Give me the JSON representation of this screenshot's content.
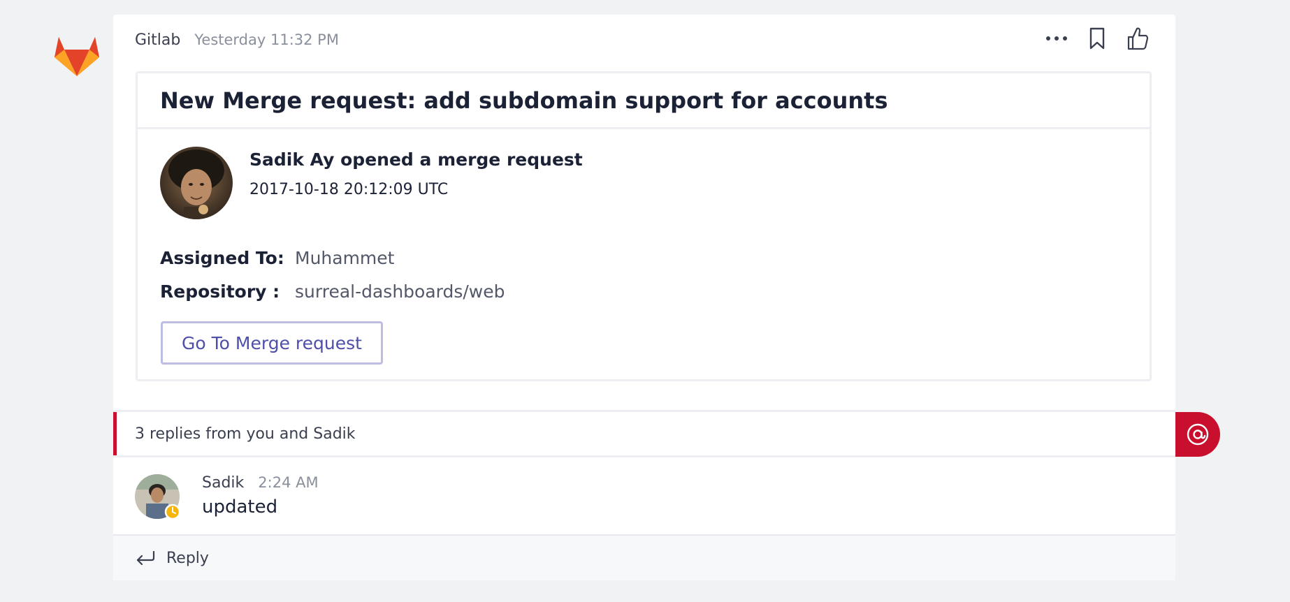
{
  "post": {
    "sender": "Gitlab",
    "timestamp": "Yesterday 11:32 PM",
    "actions": [
      {
        "icon": "more-options-icon"
      },
      {
        "icon": "bookmark-icon"
      },
      {
        "icon": "like-icon"
      }
    ]
  },
  "card": {
    "title": "New Merge request: add subdomain support for accounts",
    "author_line": "Sadik Ay opened a merge request",
    "date": "2017-10-18 20:12:09 UTC",
    "facts": [
      {
        "key": "Assigned To:",
        "value": "Muhammet"
      },
      {
        "key": "Repository :",
        "value": "surreal-dashboards/web"
      }
    ],
    "action_label": "Go To Merge request"
  },
  "replies": {
    "summary": "3 replies from you and Sadik",
    "accent_color": "#c8102e"
  },
  "reply_message": {
    "name": "Sadik",
    "time": "2:24 AM",
    "text": "updated"
  },
  "composer": {
    "reply_label": "Reply"
  },
  "colors": {
    "accent": "#c8102e",
    "button_text": "#4d4fa8",
    "gitlab_orange": "#fc6d26"
  }
}
